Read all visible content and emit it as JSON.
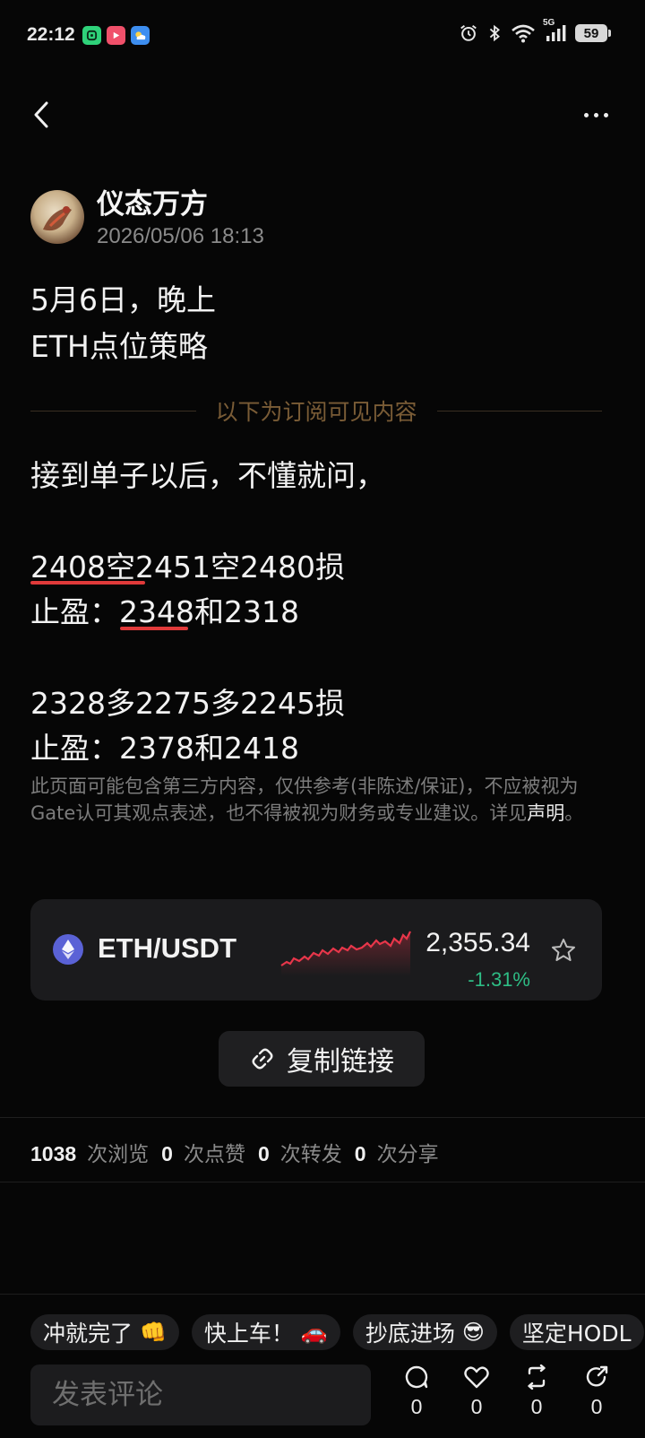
{
  "status_bar": {
    "time": "22:12",
    "battery": "59",
    "network": "5G",
    "icons": [
      "app-notification-icon",
      "video-notification-icon",
      "weather-notification-icon",
      "alarm-icon",
      "bluetooth-icon",
      "wifi-icon",
      "signal-icon",
      "battery-icon"
    ]
  },
  "nav": {
    "back_icon": "chevron-left-icon",
    "more_icon": "more-dots-icon"
  },
  "author": {
    "name": "仪态万方",
    "timestamp": "2026/05/06 18:13"
  },
  "post": {
    "title_line1": "5月6日，晚上",
    "title_line2": "ETH点位策略",
    "subscriber_divider": "以下为订阅可见内容",
    "intro": "接到单子以后，不懂就问，",
    "short_entry": "2408空2451空2480损",
    "short_tp": "止盈：2348和2318",
    "long_entry": "2328多2275多2245损",
    "long_tp": "止盈：2378和2418",
    "disclaimer": "此页面可能包含第三方内容，仅供参考(非陈述/保证)，不应被视为Gate认可其观点表述，也不得被视为财务或专业建议。详见",
    "disclaimer_link": "声明",
    "disclaimer_end": "。"
  },
  "ticker": {
    "pair": "ETH/USDT",
    "price": "2,355.34",
    "change": "-1.31%",
    "change_color": "#2ebd85",
    "sparkline_color": "#e8364a"
  },
  "copy_link": {
    "label": "复制链接"
  },
  "stats": {
    "views_count": "1038",
    "views_label": "次浏览",
    "likes_count": "0",
    "likes_label": "次点赞",
    "reposts_count": "0",
    "reposts_label": "次转发",
    "shares_count": "0",
    "shares_label": "次分享"
  },
  "quick_replies": [
    {
      "label": "冲就完了",
      "emoji": "👊"
    },
    {
      "label": "快上车！",
      "emoji": "🚗"
    },
    {
      "label": "抄底进场",
      "emoji": "😎"
    },
    {
      "label": "坚定HODL",
      "emoji": ""
    }
  ],
  "comment_box": {
    "placeholder": "发表评论"
  },
  "actions": {
    "comment_count": "0",
    "like_count": "0",
    "repost_count": "0",
    "share_count": "0"
  }
}
